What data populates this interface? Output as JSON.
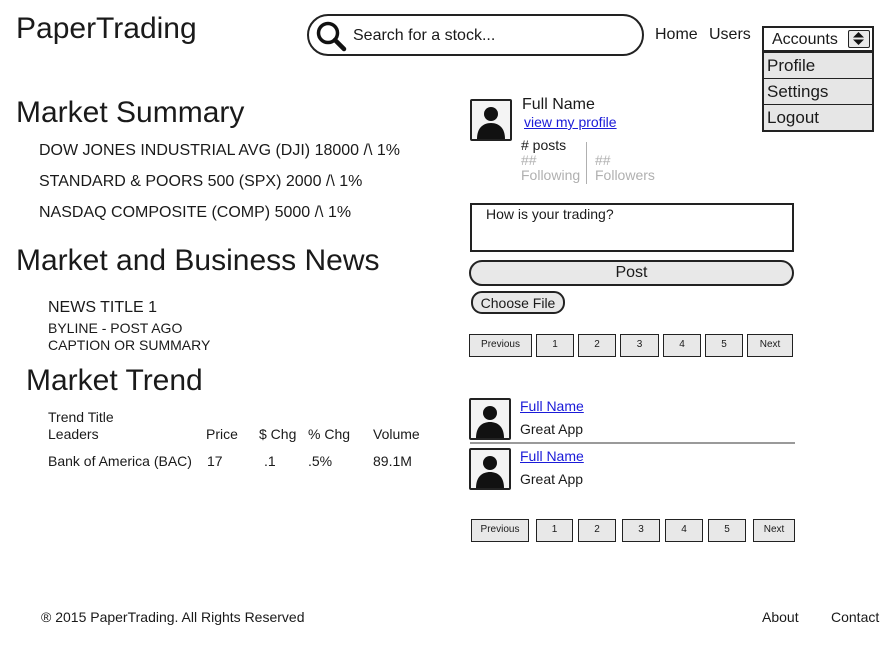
{
  "header": {
    "brand": "PaperTrading",
    "search_placeholder": "Search for a stock...",
    "nav": {
      "home": "Home",
      "users": "Users"
    },
    "accounts": {
      "selected": "Accounts",
      "menu": [
        "Profile",
        "Settings",
        "Logout"
      ]
    }
  },
  "market_summary": {
    "title": "Market Summary",
    "indices": [
      "DOW JONES INDUSTRIAL AVG (DJI) 18000 /\\ 1%",
      "STANDARD & POORS 500 (SPX) 2000 /\\ 1%",
      "NASDAQ COMPOSITE (COMP) 5000 /\\ 1%"
    ]
  },
  "news": {
    "title": "Market and Business News",
    "item": {
      "headline": "NEWS TITLE 1",
      "byline": "BYLINE - POST AGO",
      "caption": "CAPTION OR SUMMARY"
    }
  },
  "trend": {
    "title": "Market Trend",
    "table_title": "Trend Title",
    "columns": [
      "Leaders",
      "Price",
      "$ Chg",
      "% Chg",
      "Volume"
    ],
    "rows": [
      [
        "Bank of America (BAC)",
        "17",
        ".1",
        ".5%",
        "89.1M"
      ]
    ]
  },
  "profile": {
    "name": "Full Name",
    "link": "view my profile",
    "posts": "# posts",
    "following_count": "##",
    "following_label": "Following",
    "followers_count": "##",
    "followers_label": "Followers"
  },
  "composer": {
    "placeholder": "How is your trading?",
    "post_label": "Post",
    "file_label": "Choose File"
  },
  "pagination": [
    "Previous",
    "1",
    "2",
    "3",
    "4",
    "5",
    "Next"
  ],
  "feed": [
    {
      "name": "Full Name",
      "message": "Great App"
    },
    {
      "name": "Full Name",
      "message": "Great App"
    }
  ],
  "footer": {
    "copyright": "® 2015 PaperTrading. All Rights Reserved",
    "about": "About",
    "contact": "Contact"
  },
  "colors": {
    "link": "#1a1ad8",
    "button_fill": "#e8e8e8",
    "muted": "#b0b0b0"
  }
}
